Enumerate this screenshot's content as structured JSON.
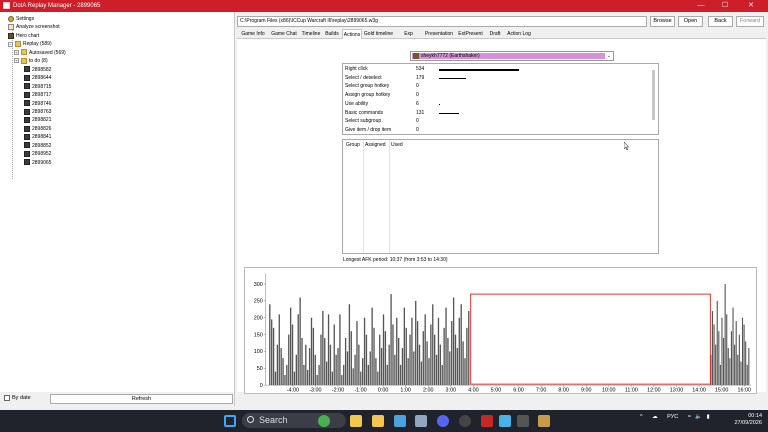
{
  "window": {
    "title": "DotA Replay Manager - 2899065",
    "minimize": "—",
    "maximize": "☐",
    "close": "✕"
  },
  "sidebar": {
    "items": [
      {
        "label": "Settings",
        "icon": "gear-icon"
      },
      {
        "label": "Analyze screenshot",
        "icon": "document-icon"
      },
      {
        "label": "Hero chart",
        "icon": "hero-icon"
      },
      {
        "label": "Replay (589)",
        "icon": "folder-icon",
        "toggle": "−"
      },
      {
        "label": "Autosaved (569)",
        "icon": "folder-icon",
        "toggle": "+"
      },
      {
        "label": "to do (8)",
        "icon": "folder-icon",
        "toggle": "+"
      },
      {
        "label": "2898582",
        "icon": "replay-icon"
      },
      {
        "label": "2898644",
        "icon": "replay-icon"
      },
      {
        "label": "2898715",
        "icon": "replay-icon"
      },
      {
        "label": "2898717",
        "icon": "replay-icon"
      },
      {
        "label": "2898746",
        "icon": "replay-icon"
      },
      {
        "label": "2898763",
        "icon": "replay-icon"
      },
      {
        "label": "2898821",
        "icon": "replay-icon"
      },
      {
        "label": "2898826",
        "icon": "replay-icon"
      },
      {
        "label": "2898841",
        "icon": "replay-icon"
      },
      {
        "label": "2898852",
        "icon": "replay-icon"
      },
      {
        "label": "2898952",
        "icon": "replay-icon"
      },
      {
        "label": "2899065",
        "icon": "replay-icon"
      }
    ],
    "by_date_label": "By date",
    "refresh_label": "Refresh"
  },
  "toolbar": {
    "path": "C:\\Program Files (x86)\\ICCup Warcraft III\\replay\\2899065.w3g",
    "browse": "Browse",
    "open": "Open",
    "back": "Back",
    "forward": "Forward"
  },
  "tabs": [
    "Game Info",
    "Game Chat",
    "Timeline",
    "Builds",
    "Actions",
    "Gold timeline",
    "Exp timeline",
    "Presentation",
    "ExtPresent",
    "Draft",
    "Action Log"
  ],
  "active_tab": "Actions",
  "player": {
    "selected": "sheykh7772 (Earthshaker)",
    "dropdown_icon": "chevron-down-icon"
  },
  "actions": [
    {
      "name": "Right click",
      "count": "534",
      "value": 534
    },
    {
      "name": "Select / deselect",
      "count": "179",
      "value": 179
    },
    {
      "name": "Select group hotkey",
      "count": "0",
      "value": 0
    },
    {
      "name": "Assign group hotkey",
      "count": "0",
      "value": 0
    },
    {
      "name": "Use ability",
      "count": "6",
      "value": 6
    },
    {
      "name": "Basic commands",
      "count": "131",
      "value": 131
    },
    {
      "name": "Select subgroup",
      "count": "0",
      "value": 0
    },
    {
      "name": "Give item / drop item",
      "count": "0",
      "value": 0
    }
  ],
  "groups": {
    "headers": [
      "Group",
      "Assigned",
      "Used"
    ]
  },
  "apk_text": "Longest AFK period: 10:37 (from 3:53 to 14:30)",
  "chart_data": {
    "type": "bar",
    "title": "",
    "xlabel": "",
    "ylabel": "",
    "ylim": [
      0,
      330
    ],
    "xlim": [
      -5.2,
      16.3
    ],
    "y_ticks": [
      0,
      50,
      100,
      150,
      200,
      250,
      300
    ],
    "x_ticks": [
      "-4:00",
      "-3:00",
      "-2:00",
      "-1:00",
      "0:00",
      "1:00",
      "2:00",
      "3:00",
      "4:00",
      "5:00",
      "6:00",
      "7:00",
      "8:00",
      "9:00",
      "10:00",
      "11:00",
      "12:00",
      "13:00",
      "14:00",
      "15:00",
      "16:00"
    ],
    "afk_region": [
      3.88,
      14.5
    ],
    "afk_color": "#e03030",
    "bar_color": "#555555",
    "bins": [
      {
        "start": -5.05,
        "end": 3.85,
        "values": [
          240,
          195,
          170,
          40,
          120,
          210,
          110,
          80,
          30,
          60,
          150,
          230,
          180,
          40,
          90,
          210,
          260,
          140,
          60,
          120,
          45,
          110,
          200,
          170,
          90,
          30,
          60,
          150,
          220,
          140,
          70,
          210,
          120,
          40,
          180,
          90,
          110,
          210,
          30,
          60,
          140,
          100,
          240,
          160,
          50,
          90,
          190,
          120,
          40,
          80,
          200,
          150,
          60,
          100,
          230,
          170,
          80,
          40,
          150,
          110,
          210,
          160,
          60,
          120,
          270,
          180,
          90,
          200,
          140,
          60,
          110,
          230,
          170,
          80,
          150,
          200,
          100,
          250,
          190,
          120,
          70,
          160,
          210,
          130,
          80,
          180,
          240,
          150,
          90,
          200,
          120,
          60,
          170,
          230,
          140,
          100,
          190,
          260,
          150,
          110,
          200,
          240,
          130,
          80,
          170,
          220
        ]
      },
      {
        "start": 14.5,
        "end": 16.25,
        "values": [
          90,
          220,
          180,
          120,
          250,
          160,
          60,
          200,
          140,
          300,
          210,
          110,
          80,
          160,
          230,
          120,
          190,
          90,
          150,
          70,
          200,
          180,
          130,
          60,
          110
        ]
      }
    ]
  },
  "taskbar": {
    "search_placeholder": "Search",
    "apps": [
      "start-icon",
      "search-icon",
      "weather-icon",
      "chrome-icon",
      "files-icon",
      "explorer-icon",
      "notepad-icon",
      "settings-icon",
      "discord-icon",
      "obs-icon",
      "red-app-icon",
      "photos-icon",
      "terminal-icon",
      "replay-manager-icon"
    ],
    "tray_lang": "РУС",
    "time": "00:14",
    "date": "27/09/2026"
  }
}
